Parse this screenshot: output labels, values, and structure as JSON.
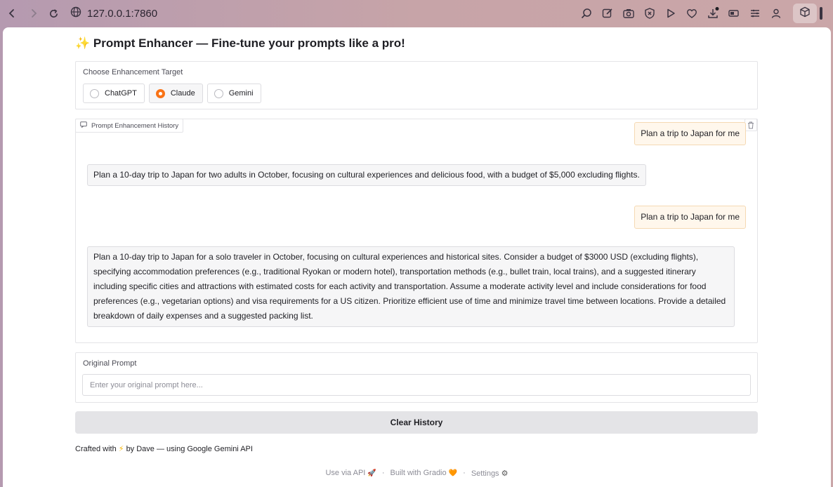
{
  "browser": {
    "url": "127.0.0.1:7860",
    "toolbar_icons": [
      "zoom-icon",
      "edit-icon",
      "camera-icon",
      "shield-x-icon",
      "play-icon",
      "heart-icon",
      "download-icon",
      "battery-icon",
      "menu-icon",
      "profile-icon"
    ]
  },
  "app": {
    "title": "✨ Prompt Enhancer — Fine-tune your prompts like a pro!"
  },
  "target": {
    "label": "Choose Enhancement Target",
    "options": [
      {
        "label": "ChatGPT",
        "selected": false
      },
      {
        "label": "Claude",
        "selected": true
      },
      {
        "label": "Gemini",
        "selected": false
      }
    ]
  },
  "history": {
    "label": "Prompt Enhancement History",
    "messages": [
      {
        "role": "user",
        "text": "Plan a trip to Japan for me"
      },
      {
        "role": "bot",
        "text": "Plan a 10-day trip to Japan for two adults in October, focusing on cultural experiences and delicious food, with a budget of $5,000 excluding flights."
      },
      {
        "role": "user",
        "text": "Plan a trip to Japan for me"
      },
      {
        "role": "bot",
        "text": "Plan a 10-day trip to Japan for a solo traveler in October, focusing on cultural experiences and historical sites. Consider a budget of $3000 USD (excluding flights), specifying accommodation preferences (e.g., traditional Ryokan or modern hotel), transportation methods (e.g., bullet train, local trains), and a suggested itinerary including specific cities and attractions with estimated costs for each activity and transportation. Assume a moderate activity level and include considerations for food preferences (e.g., vegetarian options) and visa requirements for a US citizen. Prioritize efficient use of time and minimize travel time between locations. Provide a detailed breakdown of daily expenses and a suggested packing list."
      }
    ]
  },
  "original_prompt": {
    "label": "Original Prompt",
    "placeholder": "Enter your original prompt here...",
    "value": ""
  },
  "clear_button": "Clear History",
  "credit": {
    "prefix": "Crafted with",
    "emoji": "⚡",
    "suffix": "by Dave — using Google Gemini API"
  },
  "footer": {
    "api": "Use via API",
    "api_emoji": "🚀",
    "sep": "·",
    "built": "Built with Gradio",
    "built_emoji": "🧡",
    "settings": "Settings",
    "settings_icon": "⚙"
  },
  "colors": {
    "accent": "#f97316",
    "user_bubble": "#fff7ec",
    "bot_bubble": "#f6f6f7",
    "button_bg": "#e4e4e7"
  }
}
